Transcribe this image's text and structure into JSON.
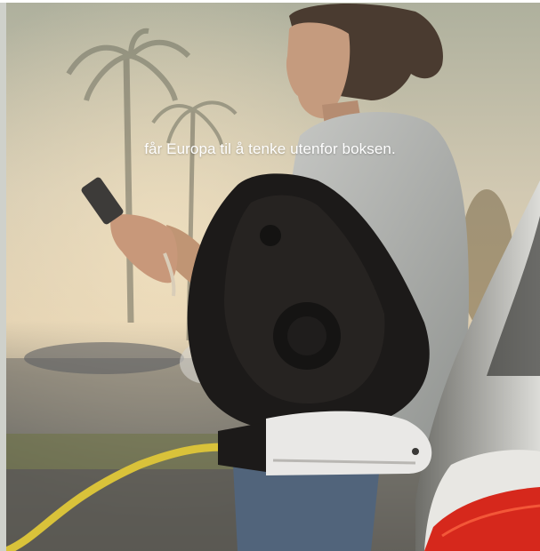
{
  "hero": {
    "tagline": "får Europa til å tenke utenfor boksen."
  },
  "colors": {
    "sky": "#cfc7b1",
    "charger_body": "#1c1a19",
    "cable": "#d9c23a",
    "plug": "#e9e8e6",
    "tail_light": "#d6281c"
  },
  "icons": {
    "charger": "ev-charger-icon",
    "plug": "charging-plug-icon"
  }
}
